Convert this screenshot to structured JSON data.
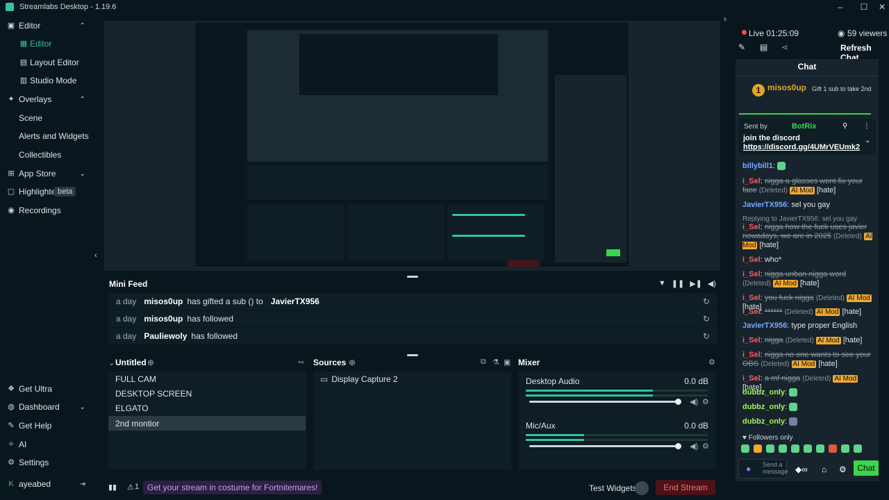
{
  "app": {
    "title": "Streamlabs Desktop - 1.19.6"
  },
  "sidebar": {
    "items": [
      {
        "label": "Editor",
        "icon": "editor-icon"
      },
      {
        "label": "Editor",
        "icon": "editor-sub-icon"
      },
      {
        "label": "Layout Editor",
        "icon": "layout-icon"
      },
      {
        "label": "Studio Mode",
        "icon": "studio-icon"
      },
      {
        "label": "Overlays",
        "icon": "overlays-icon"
      },
      {
        "label": "Scene",
        "icon": ""
      },
      {
        "label": "Alerts and Widgets",
        "icon": ""
      },
      {
        "label": "Collectibles",
        "icon": ""
      },
      {
        "label": "App Store",
        "icon": "app-store-icon"
      },
      {
        "label": "Highlighter",
        "icon": "highlighter-icon",
        "badge": "beta"
      },
      {
        "label": "Recordings",
        "icon": "recordings-icon"
      }
    ],
    "bottom": [
      {
        "label": "Get Ultra"
      },
      {
        "label": "Dashboard"
      },
      {
        "label": "Get Help"
      },
      {
        "label": "AI"
      },
      {
        "label": "Settings"
      },
      {
        "label": "ayeabed"
      }
    ]
  },
  "minifeed": {
    "title": "Mini Feed",
    "rows": [
      {
        "time": "a day",
        "user": "misos0up",
        "action": "has gifted a sub () to",
        "target": "JavierTX956"
      },
      {
        "time": "a day",
        "user": "misos0up",
        "action": "has followed",
        "target": ""
      },
      {
        "time": "a day",
        "user": "Pauliewoly",
        "action": "has followed",
        "target": ""
      }
    ]
  },
  "scenes": {
    "title": "Untitled",
    "items": [
      "FULL CAM",
      "DESKTOP SCREEN",
      "ELGATO",
      "2nd montior"
    ]
  },
  "sources": {
    "title": "Sources",
    "items": [
      "Display Capture 2"
    ]
  },
  "mixer": {
    "title": "Mixer",
    "channels": [
      {
        "name": "Desktop Audio",
        "db": "0.0 dB"
      },
      {
        "name": "Mic/Aux",
        "db": "0.0 dB"
      }
    ]
  },
  "statusbar": {
    "alerts": "1",
    "promo": "Get your stream in costume for Fortnitemares!",
    "test_widgets": "Test Widgets",
    "end_stream": "End Stream"
  },
  "chat": {
    "live": "Live 01:25:09",
    "viewers": "59 viewers",
    "refresh": "Refresh Chat",
    "title": "Chat",
    "gift_user": "misos0up",
    "gift_rank": "1",
    "gift_cta": "Gift 1 sub to take 2nd",
    "pinned_by": "Sent by",
    "pinned_user": "BotRix",
    "pinned_msg": "join the discord",
    "pinned_link": "https://discord.gg/4UMrVEUmk2",
    "messages": [
      {
        "user": "billybill1",
        "text": ""
      },
      {
        "user": "i_Sel",
        "text": "nigga a glasses wont fix your face",
        "deleted": "(Deleted)",
        "tag1": "AI Mod",
        "tag2": "[hate]"
      },
      {
        "user": "JavierTX956",
        "text": "sel you gay"
      },
      {
        "user": "",
        "text": "Replying to JavierTX956: sel you gay"
      },
      {
        "user": "i_Sel",
        "text": "nigga how the fuck uses javier nowadays, we are in 2025",
        "deleted": "(Deleted)",
        "tag1": "AI Mod",
        "tag2": "[hate]"
      },
      {
        "user": "i_Sel",
        "text": "who*"
      },
      {
        "user": "i_Sel",
        "text": "nigga unban nigga word",
        "deleted": "(Deleted)",
        "tag1": "AI Mod",
        "tag2": "[hate]"
      },
      {
        "user": "i_Sel",
        "text": "you fuck nigga",
        "deleted": "(Deleted)",
        "tag1": "AI Mod",
        "tag2": "[hate]"
      },
      {
        "user": "i_Sel",
        "text": "******",
        "deleted": "(Deleted)",
        "tag1": "AI Mod",
        "tag2": "[hate]"
      },
      {
        "user": "JavierTX956",
        "text": "type proper English"
      },
      {
        "user": "i_Sel",
        "text": "nigga",
        "deleted": "(Deleted)",
        "tag1": "AI Mod",
        "tag2": "[hate]"
      },
      {
        "user": "i_Sel",
        "text": "nigga no one wants to see your OBS",
        "deleted": "(Deleted)",
        "tag1": "AI Mod",
        "tag2": "[hate]"
      },
      {
        "user": "i_Sel",
        "text": "a mf nigga",
        "deleted": "(Deleted)",
        "tag1": "AI Mod",
        "tag2": "[hate]"
      },
      {
        "user": "dubbz_only",
        "text": ""
      },
      {
        "user": "dubbz_only",
        "text": ""
      },
      {
        "user": "dubbz_only",
        "text": ""
      }
    ],
    "followers_only": "Followers only",
    "send_placeholder": "Send a message",
    "send": "Chat"
  },
  "colors": {
    "accent": "#31c3a2",
    "bg": "#09161d",
    "panel": "#0f1d25",
    "end_stream": "#4a1319"
  }
}
